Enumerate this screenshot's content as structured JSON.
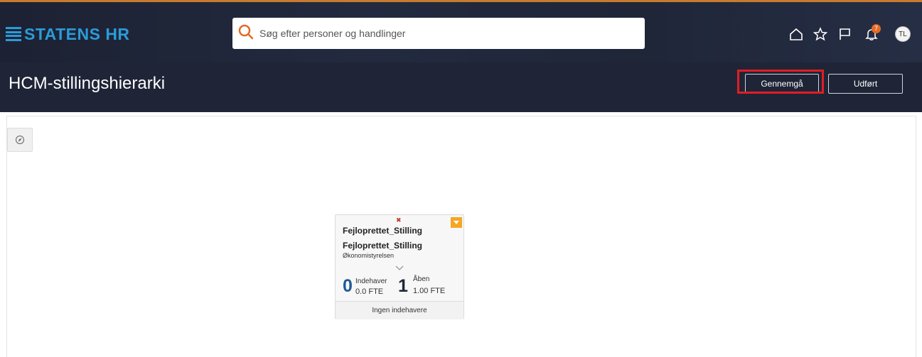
{
  "header": {
    "brand": "STATENS HR",
    "search_placeholder": "Søg efter personer og handlinger",
    "notification_count": "7",
    "avatar_initials": "TL",
    "icons": [
      "home-icon",
      "star-icon",
      "flag-icon",
      "bell-icon"
    ]
  },
  "titlebar": {
    "title": "HCM-stillingshierarki",
    "review_label": "Gennemgå",
    "done_label": "Udført"
  },
  "card": {
    "position_title": "Fejloprettet_Stilling",
    "job_title": "Fejloprettet_Stilling",
    "organization": "Økonomistyrelsen",
    "holders_count": "0",
    "holders_label": "Indehaver",
    "holders_fte": "0.0 FTE",
    "open_count": "1",
    "open_label": "Åben",
    "open_fte": "1.00 FTE",
    "footer": "Ingen indehavere"
  },
  "colors": {
    "brand": "#2b9bd9",
    "header_bg": "#1f2537",
    "highlight": "#e21d24",
    "badge": "#e56a24",
    "card_menu": "#f5a623"
  }
}
